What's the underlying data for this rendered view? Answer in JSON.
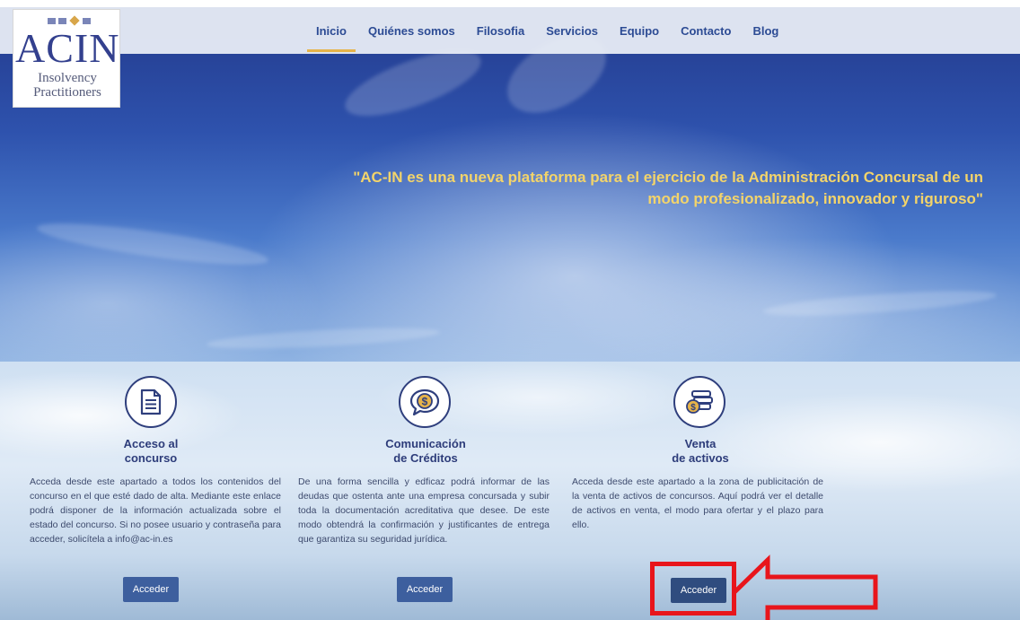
{
  "nav": {
    "items": [
      "Inicio",
      "Quiénes somos",
      "Filosofia",
      "Servicios",
      "Equipo",
      "Contacto",
      "Blog"
    ],
    "active": "Inicio"
  },
  "logo": {
    "main": "ACIN",
    "line1": "Insolvency",
    "line2": "Practitioners"
  },
  "hero": {
    "quote_line1": "\"AC-IN es una nueva plataforma para el ejercicio de la Administración Concursal de un",
    "quote_line2": "modo profesionalizado, innovador y riguroso\""
  },
  "sections": [
    {
      "title_line1": "Acceso al",
      "title_line2": "concurso",
      "text": "Acceda desde este apartado a todos los contenidos del concurso en el que esté dado de alta. Mediante este enlace podrá disponer de la información actualizada sobre el estado del concurso. Si no posee usuario y contraseña para acceder, solicítela a info@ac-in.es",
      "button": "Acceder",
      "icon": "document-icon"
    },
    {
      "title_line1": "Comunicación",
      "title_line2": "de Créditos",
      "text": "De una forma sencilla y edficaz podrá informar de las deudas que ostenta ante una empresa concursada y subir toda la documentación acreditativa que desee. De este modo obtendrá la confirmación y justificantes de entrega que garantiza su seguridad jurídica.",
      "button": "Acceder",
      "icon": "dollar-speech-bubble-icon"
    },
    {
      "title_line1": "Venta",
      "title_line2": "de activos",
      "text": "Acceda desde este apartado a la zona de publicitación de la venta de activos de concursos. Aquí podrá ver el detalle de activos en venta, el modo para ofertar y el plazo para ello.",
      "button": "Acceder",
      "icon": "coin-stack-icon"
    }
  ],
  "colors": {
    "accent_gold": "#e6b34a",
    "nav_text": "#2c4b94",
    "button": "#3d5f9e",
    "annotation_red": "#e8151b"
  }
}
